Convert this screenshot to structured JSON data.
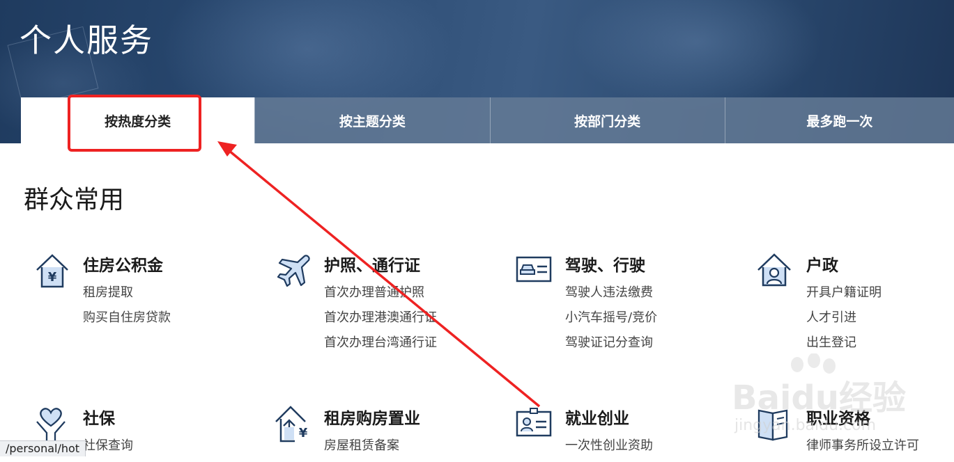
{
  "header": {
    "title": "个人服务"
  },
  "tabs": [
    {
      "label": "按热度分类",
      "active": true
    },
    {
      "label": "按主题分类"
    },
    {
      "label": "按部门分类"
    },
    {
      "label": "最多跑一次"
    }
  ],
  "section": {
    "title": "群众常用"
  },
  "categories": [
    {
      "name": "住房公积金",
      "icon": "house-yen-icon",
      "links": [
        "租房提取",
        "购买自住房贷款"
      ]
    },
    {
      "name": "护照、通行证",
      "icon": "airplane-icon",
      "links": [
        "首次办理普通护照",
        "首次办理港澳通行证",
        "首次办理台湾通行证"
      ]
    },
    {
      "name": "驾驶、行驶",
      "icon": "car-card-icon",
      "links": [
        "驾驶人违法缴费",
        "小汽车摇号/竞价",
        "驾驶证记分查询"
      ]
    },
    {
      "name": "户政",
      "icon": "house-person-icon",
      "links": [
        "开具户籍证明",
        "人才引进",
        "出生登记"
      ]
    },
    {
      "name": "社保",
      "icon": "heart-hands-icon",
      "links": [
        "社保查询"
      ]
    },
    {
      "name": "租房购房置业",
      "icon": "house-arrow-yen-icon",
      "links": [
        "房屋租赁备案"
      ]
    },
    {
      "name": "就业创业",
      "icon": "id-badge-icon",
      "links": [
        "一次性创业资助"
      ]
    },
    {
      "name": "职业资格",
      "icon": "book-icon",
      "links": [
        "律师事务所设立许可"
      ]
    }
  ],
  "status_bar": {
    "url": "/personal/hot"
  },
  "watermark": {
    "text": "Baidu经验",
    "url": "jingyan.baidu.com"
  },
  "colors": {
    "annotation": "#ee2222",
    "icon_stroke": "#1f3b5f",
    "icon_fill": "#cfe0f5"
  }
}
